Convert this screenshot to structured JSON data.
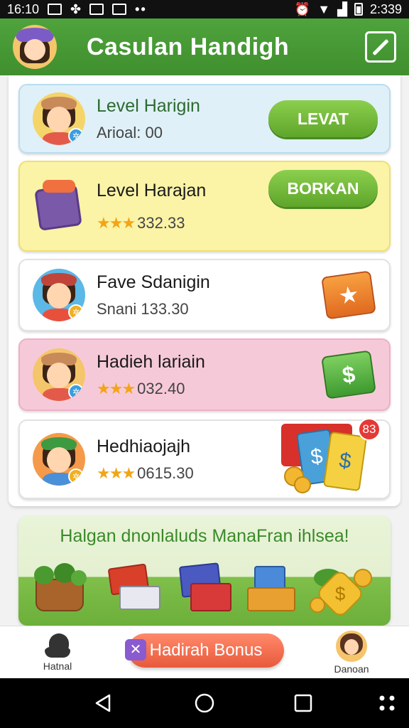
{
  "status_bar": {
    "time_left": "16:10",
    "time_right": "2:339"
  },
  "app_bar": {
    "title": "Casulan Handigh"
  },
  "cards": [
    {
      "title": "Level Harigin",
      "subtitle": "Arioal: 00",
      "button": "LEVAT",
      "bg": "#dff0f8",
      "accent": "#5cb8e6"
    },
    {
      "title": "Level Harajan",
      "subtitle": "332.33",
      "stars": "★★★",
      "button": "BORKAN",
      "bg": "#fbf3a6"
    },
    {
      "title": "Fave Sdanigin",
      "subtitle": "Snani  133.30",
      "bg": "#ffffff"
    },
    {
      "title": "Hadieh lariain",
      "subtitle": "032.40",
      "stars": "★★★",
      "bg": "#f6c9d9"
    },
    {
      "title": "Hedhiaojajh",
      "subtitle": "0615.30",
      "stars": "★★★",
      "badge_count": "83",
      "bg": "#ffffff"
    }
  ],
  "rewards": {
    "headline": "Halgan dnonlaluds ManaFran ihlsea!"
  },
  "bottom_nav": {
    "left_label": "Hatnal",
    "bonus_label": "Hadirah Bonus",
    "right_label": "Danoan"
  },
  "colors": {
    "app_bar_green": "#4fa33c",
    "button_green": "#6cb232",
    "bonus_orange": "#f07050",
    "star_gold": "#f2a516"
  }
}
